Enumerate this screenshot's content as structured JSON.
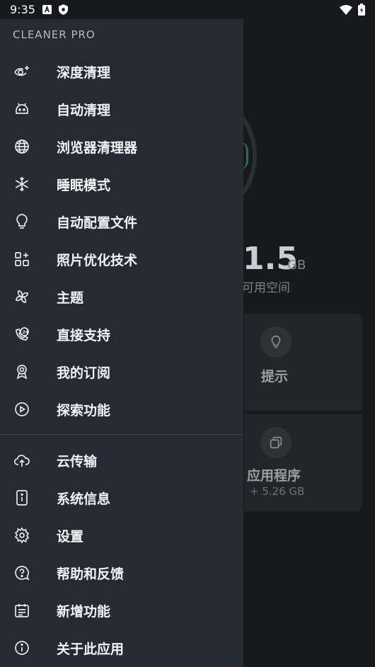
{
  "status": {
    "time": "9:35"
  },
  "background": {
    "space_value": "1.5",
    "space_unit": "GB",
    "space_label": "可用空间",
    "card_tips": {
      "title": "提示"
    },
    "card_apps": {
      "title": "应用程序",
      "sub": "+ 5.26 GB"
    }
  },
  "drawer": {
    "title": "CLEANER PRO",
    "items_top": [
      {
        "label": "深度清理",
        "icon": "eye-plus-icon"
      },
      {
        "label": "自动清理",
        "icon": "robot-icon"
      },
      {
        "label": "浏览器清理器",
        "icon": "globe-icon"
      },
      {
        "label": "睡眠模式",
        "icon": "snowflake-icon"
      },
      {
        "label": "自动配置文件",
        "icon": "lightbulb-icon"
      },
      {
        "label": "照片优化技术",
        "icon": "grid-icon"
      },
      {
        "label": "主题",
        "icon": "pinwheel-icon"
      },
      {
        "label": "直接支持",
        "icon": "support-24-icon"
      },
      {
        "label": "我的订阅",
        "icon": "badge-icon"
      },
      {
        "label": "探索功能",
        "icon": "play-circle-icon"
      }
    ],
    "items_bottom": [
      {
        "label": "云传输",
        "icon": "cloud-upload-icon"
      },
      {
        "label": "系统信息",
        "icon": "device-info-icon"
      },
      {
        "label": "设置",
        "icon": "gear-icon"
      },
      {
        "label": "帮助和反馈",
        "icon": "help-bubble-icon"
      },
      {
        "label": "新增功能",
        "icon": "calendar-list-icon"
      },
      {
        "label": "关于此应用",
        "icon": "info-circle-icon"
      }
    ]
  }
}
